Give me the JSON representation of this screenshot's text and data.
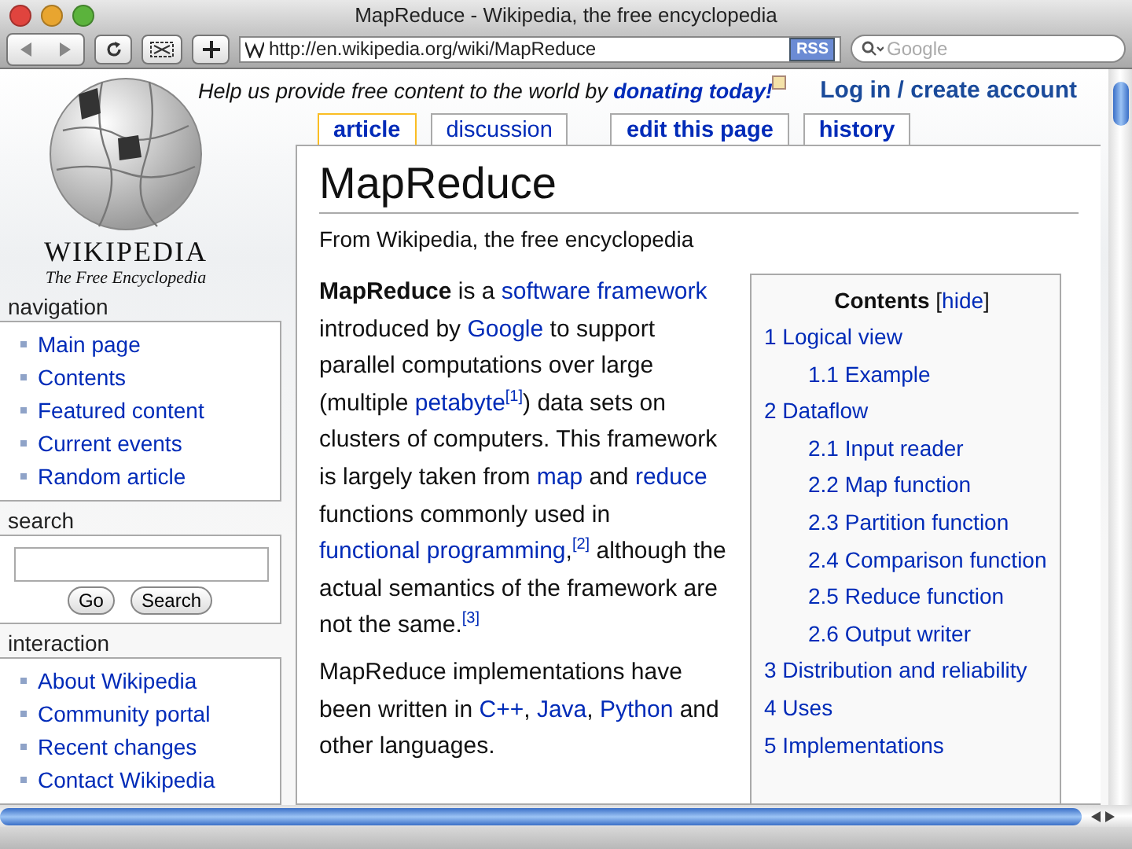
{
  "window": {
    "title": "MapReduce - Wikipedia, the free encyclopedia"
  },
  "toolbar": {
    "url": "http://en.wikipedia.org/wiki/MapReduce",
    "rss": "RSS",
    "search_placeholder": "Google"
  },
  "logo": {
    "wordmark": "WIKIPEDIA",
    "tagline": "The Free Encyclopedia"
  },
  "banner": {
    "text": "Help us provide free content to the world by",
    "link": "donating today!"
  },
  "account_link": "Log in / create account",
  "tabs": [
    {
      "label": "article",
      "selected": true,
      "kind": "view"
    },
    {
      "label": "discussion",
      "selected": false,
      "kind": "view"
    },
    {
      "label": "edit this page",
      "selected": false,
      "kind": "action"
    },
    {
      "label": "history",
      "selected": false,
      "kind": "action"
    }
  ],
  "sidebar": [
    {
      "title": "navigation",
      "kind": "links",
      "items": [
        "Main page",
        "Contents",
        "Featured content",
        "Current events",
        "Random article"
      ]
    },
    {
      "title": "search",
      "kind": "search",
      "buttons": [
        "Go",
        "Search"
      ]
    },
    {
      "title": "interaction",
      "kind": "links",
      "items": [
        "About Wikipedia",
        "Community portal",
        "Recent changes",
        "Contact Wikipedia"
      ]
    }
  ],
  "article": {
    "title": "MapReduce",
    "subtitle": "From Wikipedia, the free encyclopedia",
    "paragraphs": [
      [
        {
          "text": "MapReduce",
          "kind": "bold"
        },
        {
          "text": " is a ",
          "kind": "plain"
        },
        {
          "text": "software framework",
          "kind": "link"
        },
        {
          "text": " introduced by ",
          "kind": "plain"
        },
        {
          "text": "Google",
          "kind": "link"
        },
        {
          "text": " to support parallel computations over large (multiple ",
          "kind": "plain"
        },
        {
          "text": "petabyte",
          "kind": "link"
        },
        {
          "text": "[1]",
          "kind": "ref"
        },
        {
          "text": ") data sets on clusters of computers. This framework is largely taken from ",
          "kind": "plain"
        },
        {
          "text": "map",
          "kind": "link"
        },
        {
          "text": " and ",
          "kind": "plain"
        },
        {
          "text": "reduce",
          "kind": "link"
        },
        {
          "text": " functions commonly used in ",
          "kind": "plain"
        },
        {
          "text": "functional ",
          "kind": "link"
        },
        {
          "text": "programming",
          "kind": "link"
        },
        {
          "text": ",",
          "kind": "plain"
        },
        {
          "text": "[2]",
          "kind": "ref"
        },
        {
          "text": " although the actual semantics of the framework are not the same.",
          "kind": "plain"
        },
        {
          "text": "[3]",
          "kind": "ref"
        }
      ],
      [
        {
          "text": "MapReduce implementations have been written in ",
          "kind": "plain"
        },
        {
          "text": "C++",
          "kind": "link"
        },
        {
          "text": ", ",
          "kind": "plain"
        },
        {
          "text": "Java",
          "kind": "link"
        },
        {
          "text": ", ",
          "kind": "plain"
        },
        {
          "text": "Python",
          "kind": "link"
        },
        {
          "text": " and other languages.",
          "kind": "plain"
        }
      ]
    ]
  },
  "toc": {
    "heading": [
      {
        "text": "Contents",
        "kind": "bold"
      },
      {
        "text": " [",
        "kind": "plain"
      },
      {
        "text": "hide",
        "kind": "link"
      },
      {
        "text": "]",
        "kind": "plain"
      }
    ],
    "items": [
      {
        "label": "1 Logical view",
        "children": [
          {
            "label": "1.1 Example"
          }
        ]
      },
      {
        "label": "2 Dataflow",
        "children": [
          {
            "label": "2.1 Input reader"
          },
          {
            "label": "2.2 Map function"
          },
          {
            "label": "2.3 Partition function"
          },
          {
            "label": "2.4 Comparison function"
          },
          {
            "label": "2.5 Reduce function"
          },
          {
            "label": "2.6 Output writer"
          }
        ]
      },
      {
        "label": "3 Distribution and reliability"
      },
      {
        "label": "4 Uses"
      },
      {
        "label": "5 Implementations"
      }
    ]
  }
}
